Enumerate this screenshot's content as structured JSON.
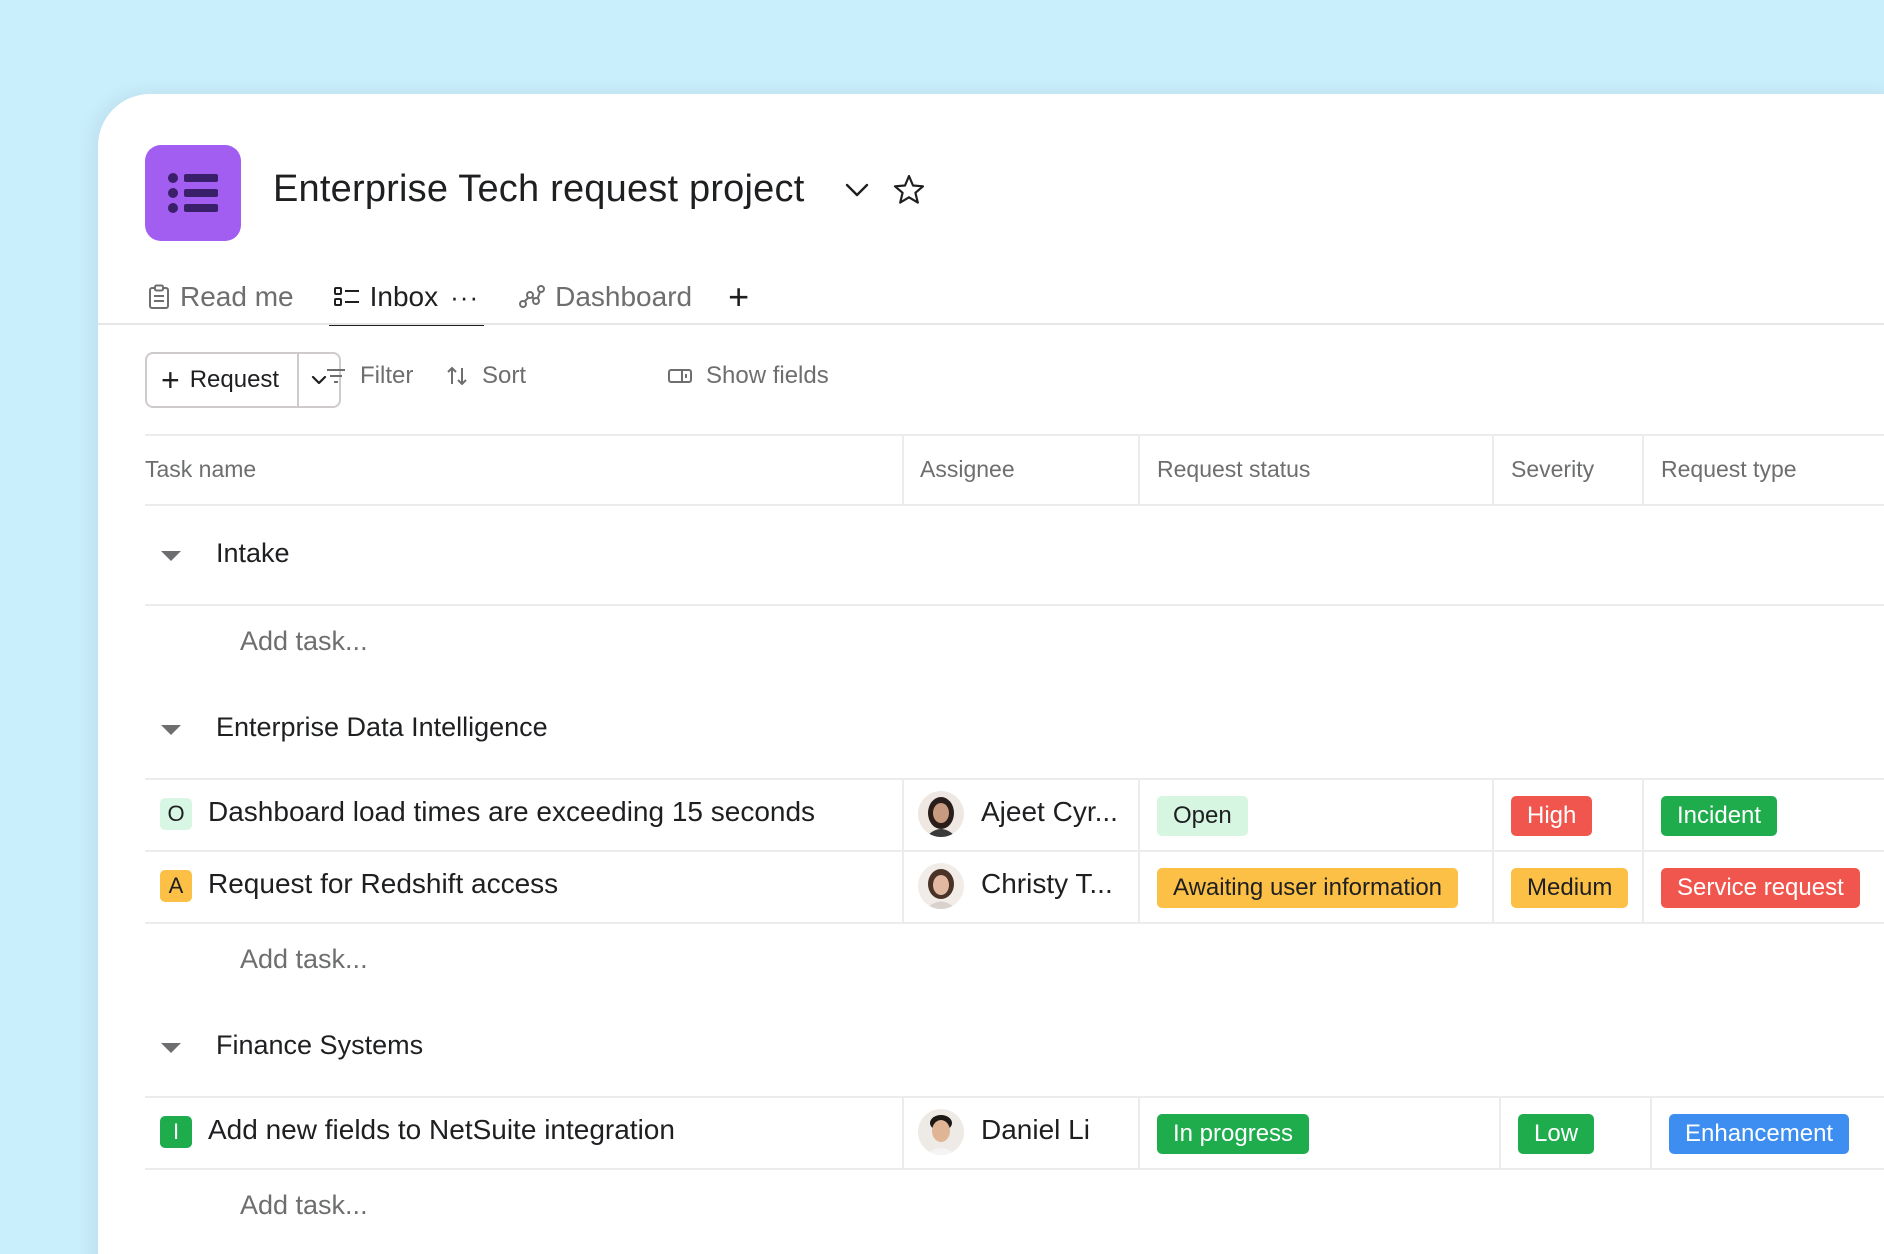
{
  "project": {
    "title": "Enterprise Tech request project",
    "icon": "list-icon",
    "icon_color": "#a25ef0"
  },
  "tabs": [
    {
      "label": "Read me",
      "icon": "clipboard-icon"
    },
    {
      "label": "Inbox",
      "icon": "list-view-icon",
      "active": true,
      "more": "···"
    },
    {
      "label": "Dashboard",
      "icon": "dashboard-icon"
    }
  ],
  "tab_add": "+",
  "toolbar": {
    "request_label": "Request",
    "request_plus": "+",
    "filter_label": "Filter",
    "sort_label": "Sort",
    "show_fields_label": "Show fields"
  },
  "columns": {
    "task_name": "Task name",
    "assignee": "Assignee",
    "request_status": "Request status",
    "severity": "Severity",
    "request_type": "Request type"
  },
  "sections": [
    {
      "title": "Intake",
      "add_task": "Add task..."
    },
    {
      "title": "Enterprise Data Intelligence",
      "add_task": "Add task..."
    },
    {
      "title": "Finance Systems",
      "add_task": "Add task..."
    }
  ],
  "tasks": [
    {
      "letter": "O",
      "letter_bg": "#d8f6e4",
      "letter_color": "#1e1f21",
      "name": "Dashboard load times are exceeding 15 seconds",
      "assignee": "Ajeet Cyr...",
      "status": "Open",
      "status_bg": "#d6f6e2",
      "status_color": "#1e1f21",
      "severity": "High",
      "severity_bg": "#f0564e",
      "severity_color": "#ffffff",
      "type": "Incident",
      "type_bg": "#1fac4d",
      "type_color": "#ffffff"
    },
    {
      "letter": "A",
      "letter_bg": "#fcc046",
      "letter_color": "#1e1f21",
      "name": "Request for Redshift access",
      "assignee": "Christy T...",
      "status": "Awaiting user information",
      "status_bg": "#fcc046",
      "status_color": "#1e1f21",
      "severity": "Medium",
      "severity_bg": "#fcc046",
      "severity_color": "#1e1f21",
      "type": "Service request",
      "type_bg": "#f0564e",
      "type_color": "#ffffff"
    },
    {
      "letter": "I",
      "letter_bg": "#1fac4d",
      "letter_color": "#ffffff",
      "name": "Add new fields to NetSuite integration",
      "assignee": "Daniel Li",
      "status": "In progress",
      "status_bg": "#1fac4d",
      "status_color": "#ffffff",
      "severity": "Low",
      "severity_bg": "#1fac4d",
      "severity_color": "#ffffff",
      "type": "Enhancement",
      "type_bg": "#3d8ef0",
      "type_color": "#ffffff"
    }
  ]
}
